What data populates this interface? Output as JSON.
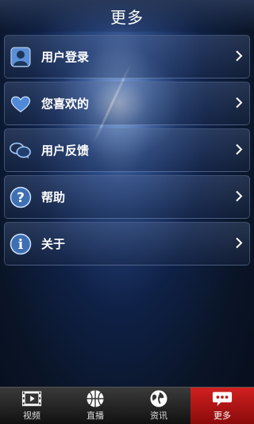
{
  "header": {
    "title": "更多"
  },
  "menu": {
    "items": [
      {
        "label": "用户登录",
        "icon": "user-login-icon"
      },
      {
        "label": "您喜欢的",
        "icon": "heart-icon"
      },
      {
        "label": "用户反馈",
        "icon": "chat-bubbles-icon"
      },
      {
        "label": "帮助",
        "icon": "help-icon"
      },
      {
        "label": "关于",
        "icon": "info-icon"
      }
    ]
  },
  "tabbar": {
    "tabs": [
      {
        "label": "视频",
        "icon": "film-icon"
      },
      {
        "label": "直播",
        "icon": "basketball-icon"
      },
      {
        "label": "资讯",
        "icon": "globe-icon"
      },
      {
        "label": "更多",
        "icon": "more-bubble-icon",
        "active": true
      }
    ]
  },
  "colors": {
    "active_tab": "#d22020",
    "background": "#0f2147"
  }
}
